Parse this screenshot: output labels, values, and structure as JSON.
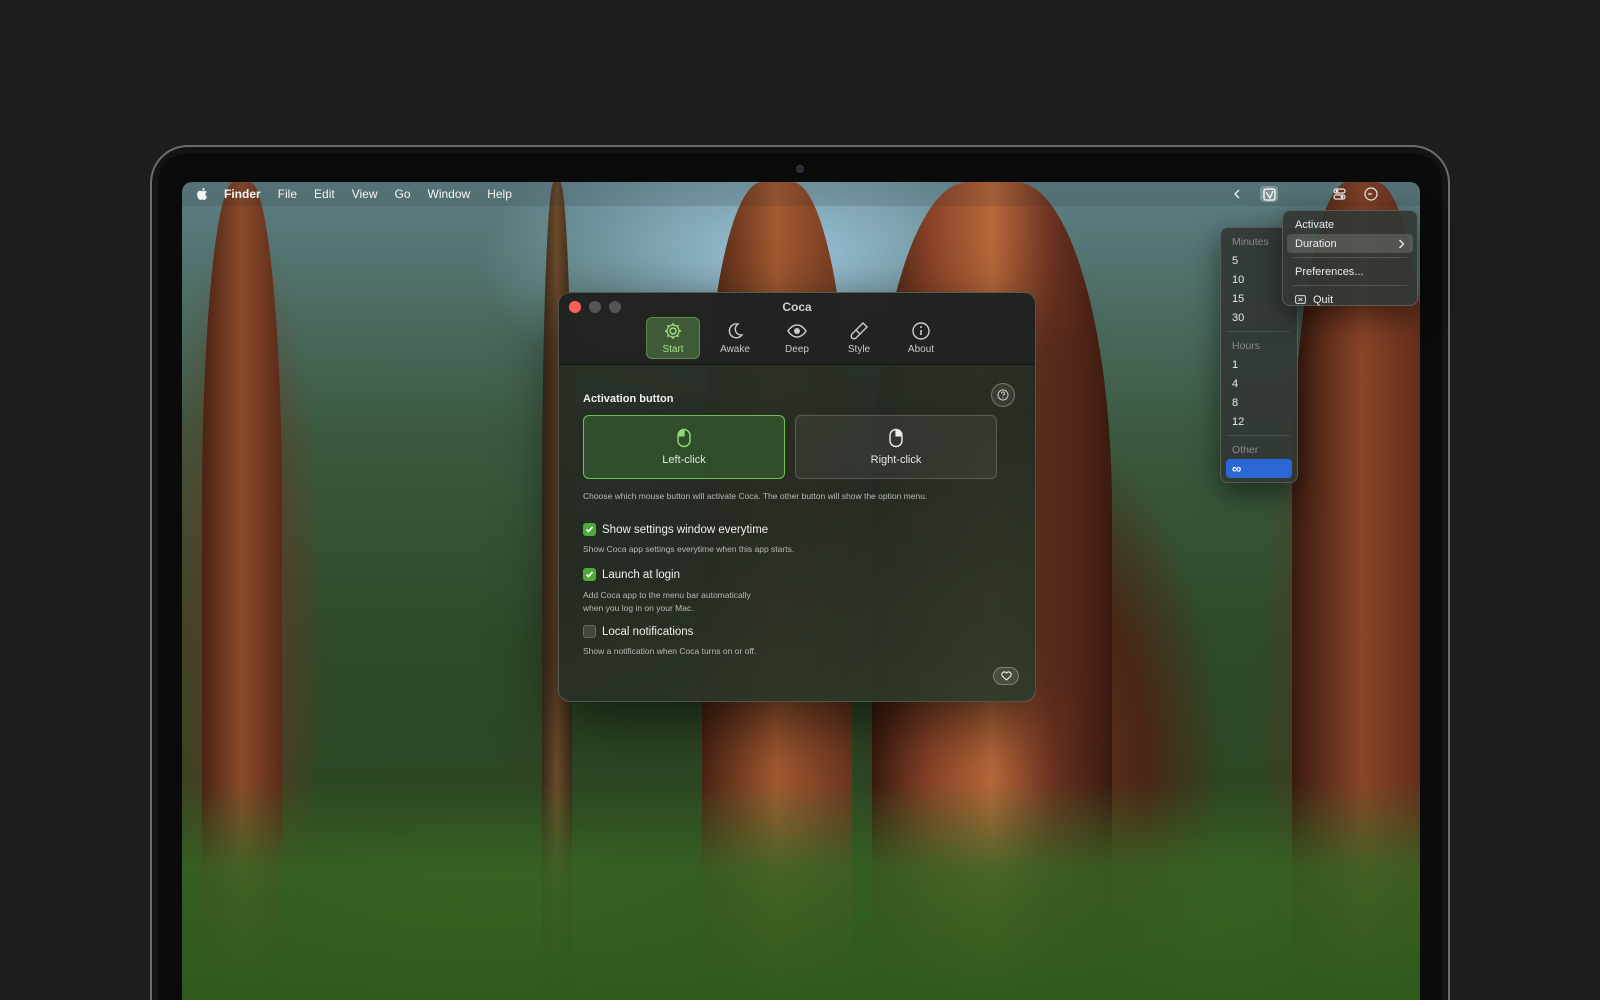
{
  "menubar": {
    "app": "Finder",
    "items": [
      "File",
      "Edit",
      "View",
      "Go",
      "Window",
      "Help"
    ]
  },
  "window": {
    "title": "Coca",
    "tabs": [
      {
        "label": "Start",
        "icon": "gear-icon",
        "active": true
      },
      {
        "label": "Awake",
        "icon": "moon-icon",
        "active": false
      },
      {
        "label": "Deep",
        "icon": "eye-icon",
        "active": false
      },
      {
        "label": "Style",
        "icon": "paintbrush-icon",
        "active": false
      },
      {
        "label": "About",
        "icon": "info-icon",
        "active": false
      }
    ],
    "section_title": "Activation button",
    "choices": [
      {
        "label": "Left-click",
        "selected": true
      },
      {
        "label": "Right-click",
        "selected": false
      }
    ],
    "choice_hint": "Choose which mouse button will activate Coca. The other button will show the option menu.",
    "options": [
      {
        "label": "Show settings window everytime",
        "checked": true,
        "hint": "Show Coca app settings everytime when this app starts."
      },
      {
        "label": "Launch at login",
        "checked": true,
        "hint": "Add Coca app to the menu bar automatically\nwhen you log in on your Mac."
      },
      {
        "label": "Local notifications",
        "checked": false,
        "hint": "Show a notification when Coca turns on or off."
      }
    ]
  },
  "main_menu": {
    "activate": "Activate",
    "duration": "Duration",
    "preferences": "Preferences...",
    "quit": "Quit"
  },
  "duration_menu": {
    "minutes_head": "Minutes",
    "minutes": [
      "5",
      "10",
      "15",
      "30"
    ],
    "hours_head": "Hours",
    "hours": [
      "1",
      "4",
      "8",
      "12"
    ],
    "other_head": "Other",
    "other": "∞"
  },
  "colors": {
    "accent_green": "#6cc456",
    "checkbox_green": "#4faa3d",
    "selection_blue": "#2b68d6"
  }
}
